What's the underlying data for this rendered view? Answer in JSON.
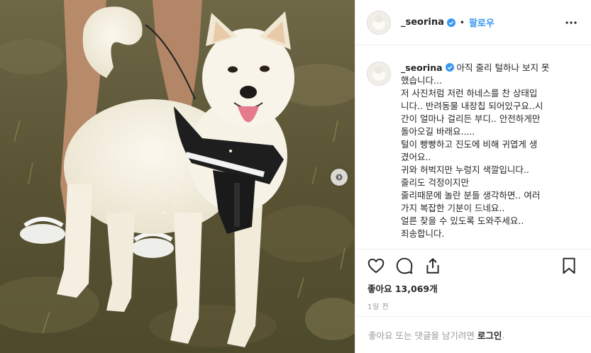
{
  "post": {
    "username": "_seorina",
    "follow_label": "팔로우",
    "dot": "•",
    "caption_lines": [
      "아직 줄리 털하나 보지 못",
      "했습니다...",
      "저 사진처럼 저런 하네스를 찬 상태입",
      "니다.. 반려동물 내장칩 되어있구요..시",
      "간이 얼마나 걸리든 부디.. 안전하게만",
      "돌아오길 바래요.....",
      "털이 빵빵하고 진도에 비해 귀엽게 생",
      "겼어요..",
      "귀와 허벅지만 누렁지 색깔입니다..",
      "줄리도 걱정이지만",
      "줄리때문에 놀란 분들 생각하면.. 여러",
      "가지 복잡한 기분이 드네요..",
      "얼른 찾을 수 있도록 도와주세요..",
      "죄송합니다."
    ],
    "likes_label": "좋아요 13,069개",
    "time_label": "1일 전",
    "login_prompt": "좋아요 또는 댓글을 남기려면",
    "login_link": "로그인",
    "login_suffix": "."
  },
  "icons": {
    "verified": "verified-badge-icon",
    "more": "more-options-icon",
    "like": "heart-icon",
    "comment": "comment-icon",
    "share": "share-icon",
    "save": "bookmark-icon",
    "next": "chevron-right-icon"
  },
  "colors": {
    "link_blue": "#3897f0",
    "text": "#262626",
    "muted": "#999999",
    "border": "#efefef"
  }
}
